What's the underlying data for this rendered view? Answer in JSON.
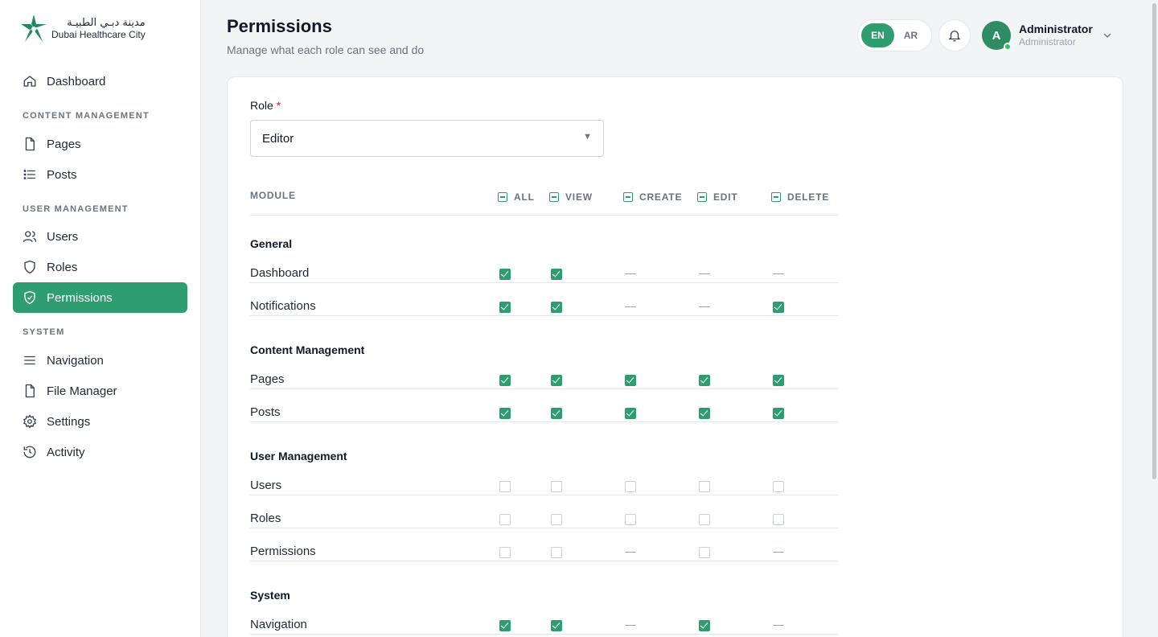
{
  "brand": {
    "arabic": "مدينة دبـي الطبيـة",
    "english": "Dubai Healthcare City"
  },
  "sidebar": {
    "dashboard": {
      "label": "Dashboard",
      "icon": "home-icon"
    },
    "sections": [
      {
        "label": "CONTENT MANAGEMENT",
        "items": [
          {
            "label": "Pages",
            "icon": "file-icon"
          },
          {
            "label": "Posts",
            "icon": "list-icon"
          }
        ]
      },
      {
        "label": "USER MANAGEMENT",
        "items": [
          {
            "label": "Users",
            "icon": "users-icon"
          },
          {
            "label": "Roles",
            "icon": "shield-icon"
          },
          {
            "label": "Permissions",
            "icon": "shield-check-icon",
            "active": true
          }
        ]
      },
      {
        "label": "SYSTEM",
        "items": [
          {
            "label": "Navigation",
            "icon": "menu-icon"
          },
          {
            "label": "File Manager",
            "icon": "file-icon"
          },
          {
            "label": "Settings",
            "icon": "gear-icon"
          },
          {
            "label": "Activity",
            "icon": "history-icon"
          }
        ]
      }
    ]
  },
  "header": {
    "title": "Permissions",
    "subtitle": "Manage what each role can see and do",
    "lang": {
      "en": "EN",
      "ar": "AR",
      "active": "EN"
    },
    "user": {
      "initial": "A",
      "name": "Administrator",
      "role": "Administrator"
    }
  },
  "form": {
    "role_label": "Role",
    "required_mark": "*",
    "role_value": "Editor",
    "arrow": "▼"
  },
  "table": {
    "columns": {
      "module": "MODULE",
      "all": "ALL",
      "view": "VIEW",
      "create": "CREATE",
      "edit": "EDIT",
      "delete": "DELETE"
    },
    "groups": [
      {
        "title": "General",
        "rows": [
          {
            "label": "Dashboard",
            "all": "on",
            "view": "on",
            "create": "na",
            "edit": "na",
            "delete": "na"
          },
          {
            "label": "Notifications",
            "all": "on",
            "view": "on",
            "create": "na",
            "edit": "na",
            "delete": "on"
          }
        ]
      },
      {
        "title": "Content Management",
        "rows": [
          {
            "label": "Pages",
            "all": "on",
            "view": "on",
            "create": "on",
            "edit": "on",
            "delete": "on"
          },
          {
            "label": "Posts",
            "all": "on",
            "view": "on",
            "create": "on",
            "edit": "on",
            "delete": "on"
          }
        ]
      },
      {
        "title": "User Management",
        "rows": [
          {
            "label": "Users",
            "all": "off",
            "view": "off",
            "create": "off",
            "edit": "off",
            "delete": "off"
          },
          {
            "label": "Roles",
            "all": "off",
            "view": "off",
            "create": "off",
            "edit": "off",
            "delete": "off"
          },
          {
            "label": "Permissions",
            "all": "off",
            "view": "off",
            "create": "na",
            "edit": "off",
            "delete": "na"
          }
        ]
      },
      {
        "title": "System",
        "rows": [
          {
            "label": "Navigation",
            "all": "on",
            "view": "on",
            "create": "na",
            "edit": "on",
            "delete": "na"
          }
        ]
      }
    ]
  },
  "colors": {
    "accent": "#2e9e71",
    "avatar": "#2e8c65",
    "online": "#22c55e",
    "required": "#dc2626"
  }
}
